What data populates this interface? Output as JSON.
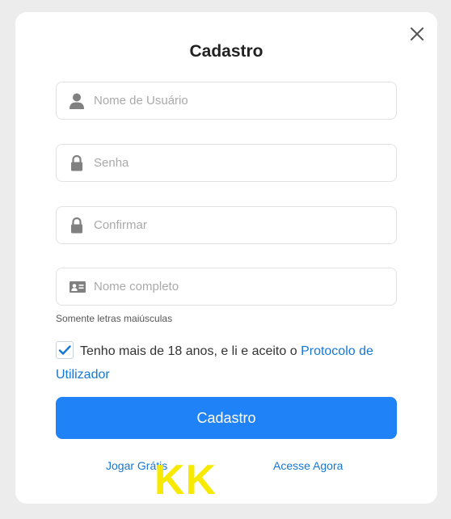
{
  "dialog": {
    "title": "Cadastro"
  },
  "form": {
    "username": {
      "placeholder": "Nome de Usuário",
      "icon": "user-icon"
    },
    "password": {
      "placeholder": "Senha",
      "icon": "lock-icon"
    },
    "confirm": {
      "placeholder": "Confirmar",
      "icon": "lock-icon"
    },
    "fullname": {
      "placeholder": "Nome completo",
      "icon": "id-card-icon"
    },
    "fullname_hint": "Somente letras maiúsculas",
    "agreement": {
      "checked": true,
      "text": "Tenho mais de 18 anos, e li e aceito o ",
      "link": "Protocolo de Utilizador"
    },
    "submit_label": "Cadastro"
  },
  "footer": {
    "play_free": "Jogar Grátis",
    "login_now": "Acesse Agora"
  },
  "watermark": "KK",
  "colors": {
    "accent": "#1f82f6",
    "link": "#1677d2",
    "watermark": "#f7ea00"
  }
}
